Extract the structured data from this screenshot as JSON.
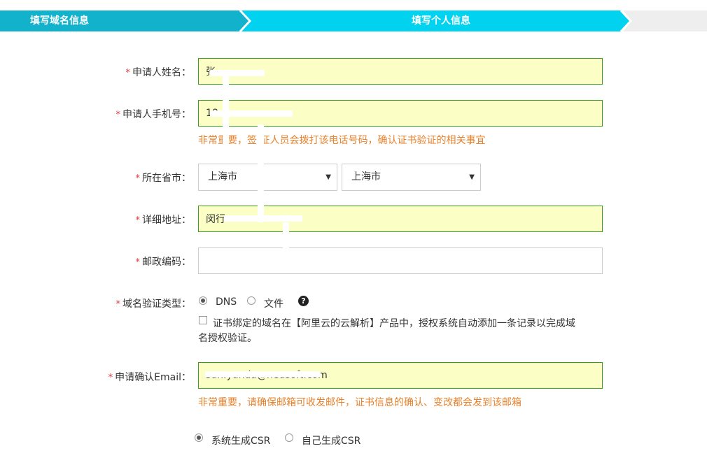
{
  "steps": {
    "step1": "填写域名信息",
    "step2": "填写个人信息",
    "colors": {
      "done": "#12b1cc",
      "current": "#00d2f0",
      "pending": "#eeeeee"
    }
  },
  "form": {
    "required_mark": "*",
    "applicant_name": {
      "label": "申请人姓名：",
      "value": "张"
    },
    "phone": {
      "label": "申请人手机号：",
      "value": "18",
      "hint": "非常重要，签 证人员会拨打该电话号码，确认证书验证的相关事宜"
    },
    "region": {
      "label": "所在省市：",
      "province": "上海市",
      "city": "上海市"
    },
    "address": {
      "label": "详细地址：",
      "value": "闵行"
    },
    "postcode": {
      "label": "邮政编码：",
      "value": ""
    },
    "verify_type": {
      "label": "域名验证类型：",
      "options": [
        "DNS",
        "文件"
      ],
      "selected": "DNS",
      "help": "?",
      "auto_add_line1": "证书绑定的域名在【阿里云的云解析】产品中，授权系统自动添加一条记录以完成域",
      "auto_add_line2": "名授权验证。"
    },
    "email": {
      "label": "申请确认Email：",
      "value": "sun.yunda@neusoft.com",
      "hint": "非常重要，请确保邮箱可收发邮件，证书信息的确认、变改都会发到该邮箱"
    },
    "csr": {
      "options": [
        "系统生成CSR",
        "自己生成CSR"
      ],
      "selected": "系统生成CSR"
    }
  }
}
